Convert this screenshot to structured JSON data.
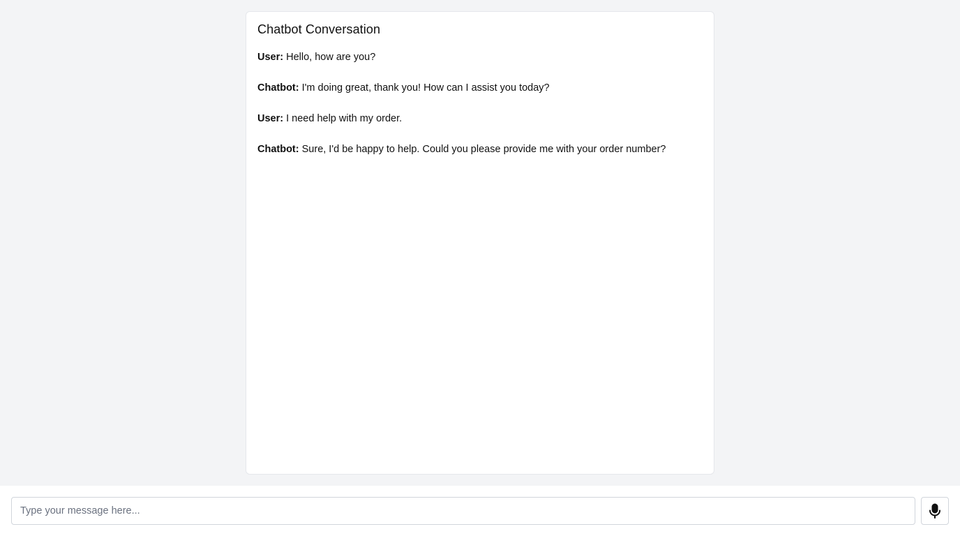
{
  "chat": {
    "title": "Chatbot Conversation",
    "messages": [
      {
        "sender": "User:",
        "text": "Hello, how are you?"
      },
      {
        "sender": "Chatbot:",
        "text": "I'm doing great, thank you! How can I assist you today?"
      },
      {
        "sender": "User:",
        "text": "I need help with my order."
      },
      {
        "sender": "Chatbot:",
        "text": "Sure, I'd be happy to help. Could you please provide me with your order number?"
      }
    ]
  },
  "input": {
    "placeholder": "Type your message here...",
    "value": ""
  },
  "mic_button": {
    "icon": "microphone-icon"
  },
  "colors": {
    "page_background": "#f3f4f6",
    "panel_background": "#ffffff",
    "border": "#e5e7eb",
    "text": "#111111",
    "placeholder": "#6b7280"
  }
}
